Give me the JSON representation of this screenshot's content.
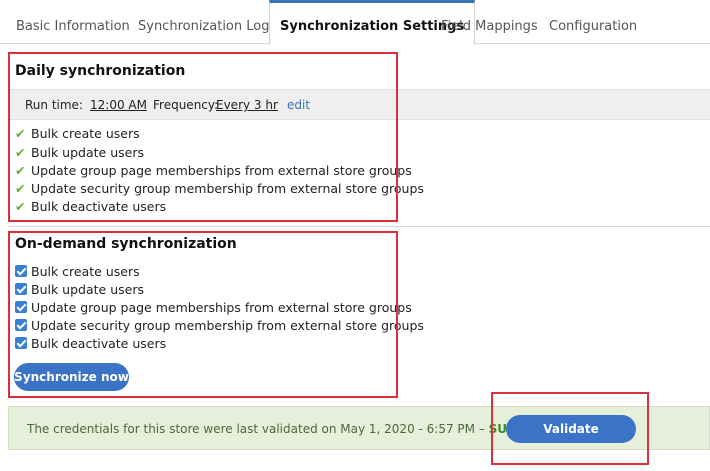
{
  "tabs": [
    {
      "label": "Basic Information"
    },
    {
      "label": "Synchronization Logs"
    },
    {
      "label": "Synchronization Settings"
    },
    {
      "label": "Field Mappings"
    },
    {
      "label": "Configuration"
    }
  ],
  "active_tab": "Synchronization Settings",
  "daily": {
    "title": "Daily synchronization",
    "run_time_label": "Run time:",
    "run_time_value": "12:00 AM",
    "frequency_label": "Frequency:",
    "frequency_value": "Every 3 hr",
    "edit_label": "edit",
    "items": [
      {
        "label": "Bulk create users"
      },
      {
        "label": "Bulk update users"
      },
      {
        "label": "Update group page memberships from external store groups"
      },
      {
        "label": "Update security group membership from external store groups"
      },
      {
        "label": "Bulk deactivate users"
      }
    ]
  },
  "on_demand": {
    "title": "On-demand synchronization",
    "items": [
      {
        "label": "Bulk create users",
        "checked": true
      },
      {
        "label": "Bulk update users",
        "checked": true
      },
      {
        "label": "Update group page memberships from external store groups",
        "checked": true
      },
      {
        "label": "Update security group membership from external store groups",
        "checked": true
      },
      {
        "label": "Bulk deactivate users",
        "checked": true
      }
    ],
    "sync_button": "Synchronize now"
  },
  "credentials": {
    "message": "The credentials for this store were last validated on May 1, 2020 - 6:57 PM – ",
    "status": "SUCCESS",
    "validate_button": "Validate credentials"
  },
  "colors": {
    "accent": "#3b73c7",
    "check_green": "#5cb531",
    "highlight_red": "#d9323a",
    "success_bg": "#e6efd9"
  }
}
